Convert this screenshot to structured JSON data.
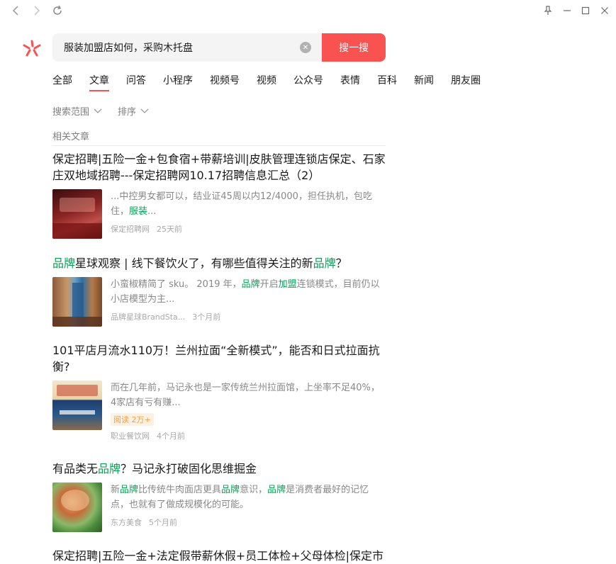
{
  "search": {
    "query": "服装加盟店如何，采购木托盘",
    "button_label": "搜一搜"
  },
  "tabs": [
    {
      "label": "全部"
    },
    {
      "label": "文章",
      "active": true
    },
    {
      "label": "问答"
    },
    {
      "label": "小程序"
    },
    {
      "label": "视频号"
    },
    {
      "label": "视频"
    },
    {
      "label": "公众号"
    },
    {
      "label": "表情"
    },
    {
      "label": "百科"
    },
    {
      "label": "新闻"
    },
    {
      "label": "朋友圈"
    }
  ],
  "filters": {
    "scope_label": "搜索范围",
    "sort_label": "排序"
  },
  "section_label": "相关文章",
  "results": [
    {
      "title_parts": [
        {
          "text": "保定招聘|五险一金+包食宿+带薪培训|皮肤管理连锁店保定、石家庄双地域招聘---保定招聘网10.17招聘信息汇总（2）",
          "hl": false
        }
      ],
      "snippet_parts": [
        {
          "text": "...中控男女都可以，结业证45周以内12/4000，担任执机，包吃住，",
          "hl": false
        },
        {
          "text": "服装",
          "hl": true
        },
        {
          "text": "...",
          "hl": false
        }
      ],
      "source": "保定招聘网",
      "time": "25天前"
    },
    {
      "title_parts": [
        {
          "text": "品牌",
          "hl": true
        },
        {
          "text": "星球观察 | 线下餐饮火了，有哪些值得关注的新",
          "hl": false
        },
        {
          "text": "品牌",
          "hl": true
        },
        {
          "text": "？",
          "hl": false
        }
      ],
      "snippet_parts": [
        {
          "text": "小蛮椒精简了 sku。 2019 年，",
          "hl": false
        },
        {
          "text": "品牌",
          "hl": true
        },
        {
          "text": "开启",
          "hl": false
        },
        {
          "text": "加盟",
          "hl": true
        },
        {
          "text": "连锁模式，目前仍以小店模型为主...",
          "hl": false
        }
      ],
      "source": "品牌星球BrandSta...",
      "time": "3个月前"
    },
    {
      "title_parts": [
        {
          "text": "101平店月流水110万！兰州拉面“全新模式”，能否和日式拉面抗衡?",
          "hl": false
        }
      ],
      "snippet_parts": [
        {
          "text": "而在几年前，马记永也是一家传统兰州拉面馆，上坐率不足40%，4家店有亏有赚...",
          "hl": false
        }
      ],
      "badge": "阅读 2万+",
      "source": "职业餐饮网",
      "time": "4个月前"
    },
    {
      "title_parts": [
        {
          "text": "有品类无",
          "hl": false
        },
        {
          "text": "品牌",
          "hl": true
        },
        {
          "text": "？马记永打破固化思维掘金",
          "hl": false
        }
      ],
      "snippet_parts": [
        {
          "text": "新",
          "hl": false
        },
        {
          "text": "品牌",
          "hl": true
        },
        {
          "text": "比传统牛肉面店更具",
          "hl": false
        },
        {
          "text": "品牌",
          "hl": true
        },
        {
          "text": "意识，",
          "hl": false
        },
        {
          "text": "品牌",
          "hl": true
        },
        {
          "text": "是消费者最好的记忆点，也就有了做成规模化的可能。",
          "hl": false
        }
      ],
      "source": "东方美食",
      "time": "5个月前"
    },
    {
      "title_parts": [
        {
          "text": "保定招聘|五险一金+法定假带薪休假+员工体检+父母体检|保定市",
          "hl": false
        }
      ]
    }
  ],
  "colors": {
    "accent": "#fa5151",
    "highlight": "#07a053",
    "badge_bg": "#fdf1e4",
    "badge_text": "#fa9d3b"
  },
  "icons": [
    "back-arrow-icon",
    "forward-arrow-icon",
    "refresh-icon",
    "pin-icon",
    "minimize-icon",
    "maximize-icon",
    "close-icon",
    "sousou-logo-icon",
    "clear-icon",
    "chevron-down-icon"
  ]
}
